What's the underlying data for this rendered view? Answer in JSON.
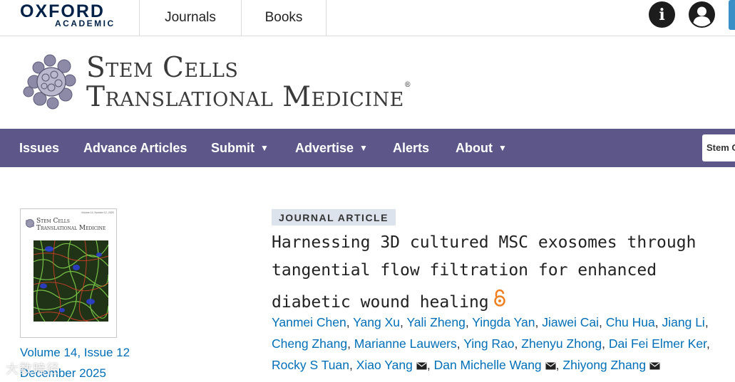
{
  "topbar": {
    "brand_main": "OXFORD",
    "brand_sub": "ACADEMIC",
    "journals_label": "Journals",
    "books_label": "Books",
    "info_icon": "info-icon",
    "user_icon": "account-icon"
  },
  "masthead": {
    "title_line1": "Stem Cells",
    "title_line2": "Translational Medicine",
    "registered_mark": "®"
  },
  "nav": {
    "items": [
      {
        "label": "Issues",
        "dropdown": false
      },
      {
        "label": "Advance Articles",
        "dropdown": false
      },
      {
        "label": "Submit",
        "dropdown": true
      },
      {
        "label": "Advertise",
        "dropdown": true
      },
      {
        "label": "Alerts",
        "dropdown": false
      },
      {
        "label": "About",
        "dropdown": true
      }
    ],
    "caret": "▼",
    "search_stub": "Stem C",
    "nav_bg": "#5d5789"
  },
  "issue": {
    "cover_title_line1": "Stem Cells",
    "cover_title_line2": "Translational Medicine",
    "cover_sub": "Volume 14, Number 12, 2025",
    "volume_label": "Volume 14, Issue 12",
    "date_label": "December 2025"
  },
  "article": {
    "type_badge": "JOURNAL ARTICLE",
    "title_line1": "Harnessing 3D cultured MSC exosomes through",
    "title_line2": "tangential flow filtration for enhanced",
    "title_line3": "diabetic wound healing",
    "open_access_icon": "open-access-icon",
    "authors_row1": [
      "Yanmei Chen",
      "Yang Xu",
      "Yali Zheng",
      "Yingda Yan",
      "Jiawei Cai",
      "Chu Hua",
      "Jiang Li"
    ],
    "authors_row2": [
      "Cheng Zhang",
      "Marianne Lauwers",
      "Ying Rao",
      "Zhenyu Zhong",
      "Dai Fei Elmer Ker"
    ],
    "authors_row3": [
      "Rocky S Tuan",
      "Xiao Yang",
      "Dan Michelle Wang",
      "Zhiyong Zhang"
    ],
    "corresponding_authors": [
      "Xiao Yang",
      "Dan Michelle Wang",
      "Zhiyong Zhang"
    ],
    "link_color": "#006fb7"
  },
  "watermark": "大数暗径"
}
